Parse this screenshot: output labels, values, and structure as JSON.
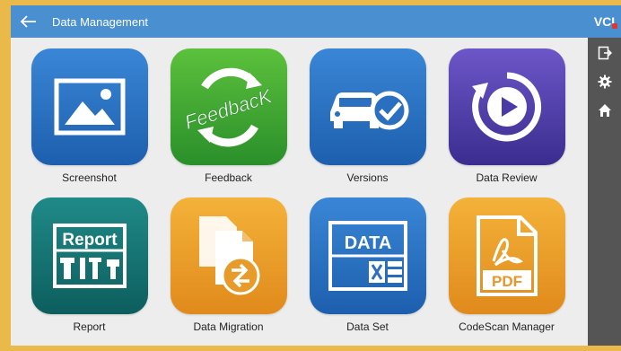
{
  "header": {
    "title": "Data Management",
    "back_icon": "arrow-left-icon"
  },
  "side_rail": {
    "vci_label": "VCI",
    "vci_status_color": "#e3342f",
    "buttons": [
      {
        "icon": "exit-icon"
      },
      {
        "icon": "gear-icon"
      },
      {
        "icon": "home-icon"
      }
    ]
  },
  "tiles": [
    {
      "label": "Screenshot",
      "icon": "image-icon",
      "color_top": "#3a86d6",
      "color_bottom": "#1d5fae"
    },
    {
      "label": "Feedback",
      "icon": "feedback-recycle-icon",
      "icon_text": "FeedbacK",
      "color_top": "#5cc13c",
      "color_bottom": "#2a8f2a"
    },
    {
      "label": "Versions",
      "icon": "car-check-icon",
      "color_top": "#3a86d6",
      "color_bottom": "#1d5fae"
    },
    {
      "label": "Data Review",
      "icon": "play-refresh-icon",
      "color_top": "#6d56c8",
      "color_bottom": "#3a2d8f"
    },
    {
      "label": "Report",
      "icon": "report-tools-icon",
      "icon_text": "Report",
      "color_top": "#1f8a88",
      "color_bottom": "#0d5e5e"
    },
    {
      "label": "Data Migration",
      "icon": "file-transfer-icon",
      "color_top": "#f4b23a",
      "color_bottom": "#e08a1b"
    },
    {
      "label": "Data Set",
      "icon": "data-excel-icon",
      "icon_text": "DATA",
      "color_top": "#3a86d6",
      "color_bottom": "#1d5fae"
    },
    {
      "label": "CodeScan Manager",
      "icon": "pdf-file-icon",
      "icon_text": "PDF",
      "color_top": "#f4b23a",
      "color_bottom": "#e08a1b"
    }
  ],
  "colors": {
    "header_blue": "#4a8fd0",
    "rail_gray": "#555555",
    "background": "#ededed"
  }
}
